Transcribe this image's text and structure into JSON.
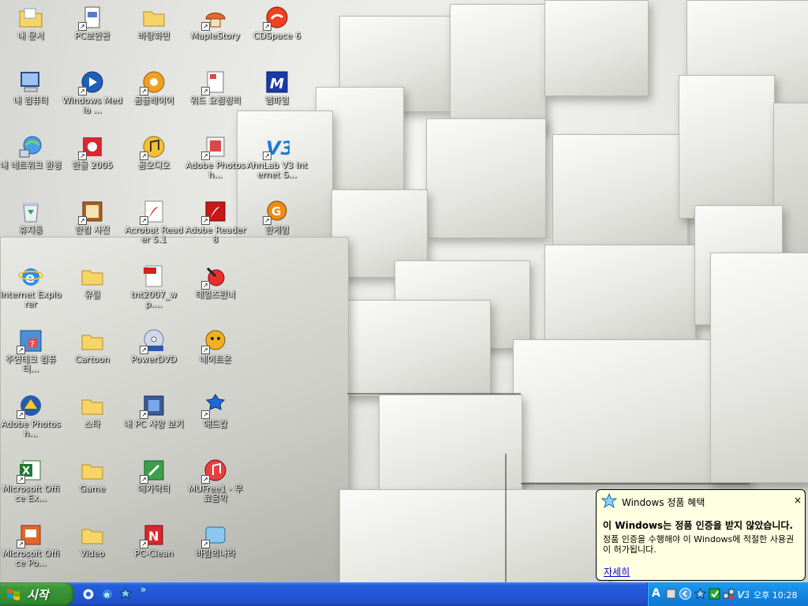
{
  "desktop": {
    "columns": [
      [
        {
          "label": "내 문서",
          "icon": "documents-folder-icon",
          "shortcut": false
        },
        {
          "label": "내 컴퓨터",
          "icon": "my-computer-icon",
          "shortcut": false
        },
        {
          "label": "내 네트워크 환경",
          "icon": "network-places-icon",
          "shortcut": false
        },
        {
          "label": "휴지통",
          "icon": "recycle-bin-icon",
          "shortcut": false
        },
        {
          "label": "Internet Explorer",
          "icon": "internet-explorer-icon",
          "shortcut": false
        },
        {
          "label": "주연테크 컴퓨터...",
          "icon": "help-support-icon",
          "shortcut": true
        },
        {
          "label": "Adobe Photosh...",
          "icon": "photoshop-icon",
          "shortcut": true
        },
        {
          "label": "Microsoft Office Ex...",
          "icon": "excel-icon",
          "shortcut": true
        },
        {
          "label": "Microsoft Office Po...",
          "icon": "powerpoint-icon",
          "shortcut": true
        }
      ],
      [
        {
          "label": "PC보안관",
          "icon": "document-icon",
          "shortcut": true
        },
        {
          "label": "Windows Media ...",
          "icon": "media-player-icon",
          "shortcut": true
        },
        {
          "label": "한글 2005",
          "icon": "hangul-icon",
          "shortcut": true
        },
        {
          "label": "한컴 사전",
          "icon": "dictionary-icon",
          "shortcut": true
        },
        {
          "label": "유틸",
          "icon": "folder-icon",
          "shortcut": false
        },
        {
          "label": "Cartoon",
          "icon": "folder-icon",
          "shortcut": false
        },
        {
          "label": "스타",
          "icon": "folder-icon",
          "shortcut": false
        },
        {
          "label": "Game",
          "icon": "folder-icon",
          "shortcut": false
        },
        {
          "label": "Video",
          "icon": "folder-icon",
          "shortcut": false
        }
      ],
      [
        {
          "label": "바탕화면",
          "icon": "folder-icon",
          "shortcut": false
        },
        {
          "label": "곰플레이어",
          "icon": "gom-player-icon",
          "shortcut": true
        },
        {
          "label": "곰오디오",
          "icon": "gom-audio-icon",
          "shortcut": true
        },
        {
          "label": "Acrobat Reader 5.1",
          "icon": "acrobat-icon",
          "shortcut": true
        },
        {
          "label": "tnt2007_wp....",
          "icon": "pdf-file-icon",
          "shortcut": false
        },
        {
          "label": "PowerDVD",
          "icon": "dvd-icon",
          "shortcut": true
        },
        {
          "label": "내 PC 사양 보기",
          "icon": "pc-spec-icon",
          "shortcut": true
        },
        {
          "label": "메가닥터",
          "icon": "mega-doctor-icon",
          "shortcut": true
        },
        {
          "label": "PC-Clean",
          "icon": "pc-clean-icon",
          "shortcut": true
        }
      ],
      [
        {
          "label": "MapleStory",
          "icon": "maplestory-icon",
          "shortcut": true
        },
        {
          "label": "워드 요점정리",
          "icon": "word-note-icon",
          "shortcut": true
        },
        {
          "label": "Adobe Photosh...",
          "icon": "photoshop-icon",
          "shortcut": true
        },
        {
          "label": "Adobe Reader 8",
          "icon": "adobe-reader-icon",
          "shortcut": true
        },
        {
          "label": "테일즈런너",
          "icon": "talesrunner-icon",
          "shortcut": true
        },
        {
          "label": "네이트온",
          "icon": "nateon-icon",
          "shortcut": true
        },
        {
          "label": "애드캅",
          "icon": "adcop-icon",
          "shortcut": true
        },
        {
          "label": "MUFree1 - 무료음악",
          "icon": "music-icon",
          "shortcut": true
        },
        {
          "label": "바람의나라",
          "icon": "baram-icon",
          "shortcut": true
        }
      ],
      [
        {
          "label": "CDSpace 6",
          "icon": "cdspace-icon",
          "shortcut": true
        },
        {
          "label": "엠파일",
          "icon": "mfile-icon",
          "shortcut": true
        },
        {
          "label": "AhnLab V3 Internet S...",
          "icon": "v3-icon",
          "shortcut": true
        },
        {
          "label": "한게임",
          "icon": "hangame-icon",
          "shortcut": true
        }
      ]
    ]
  },
  "taskbar": {
    "start_label": "시작",
    "quick_launch": [
      "show-desktop-icon",
      "internet-explorer-icon",
      "messenger-icon"
    ],
    "more": "»",
    "tray_icons": [
      "language-icon",
      "tray-chevron-icon",
      "activation-star-icon",
      "security-check-icon",
      "network-icon",
      "antivirus-icon"
    ],
    "tray_language": "A",
    "clock": "오후 10:28"
  },
  "balloon": {
    "title": "Windows 정품 혜택",
    "close": "×",
    "heading": "이 Windows는 정품 인증을 받지 않았습니다.",
    "body": "정품 인증을 수행해야 이 Windows에 적절한 사용권이 허가됩니다.",
    "link": "자세히"
  }
}
